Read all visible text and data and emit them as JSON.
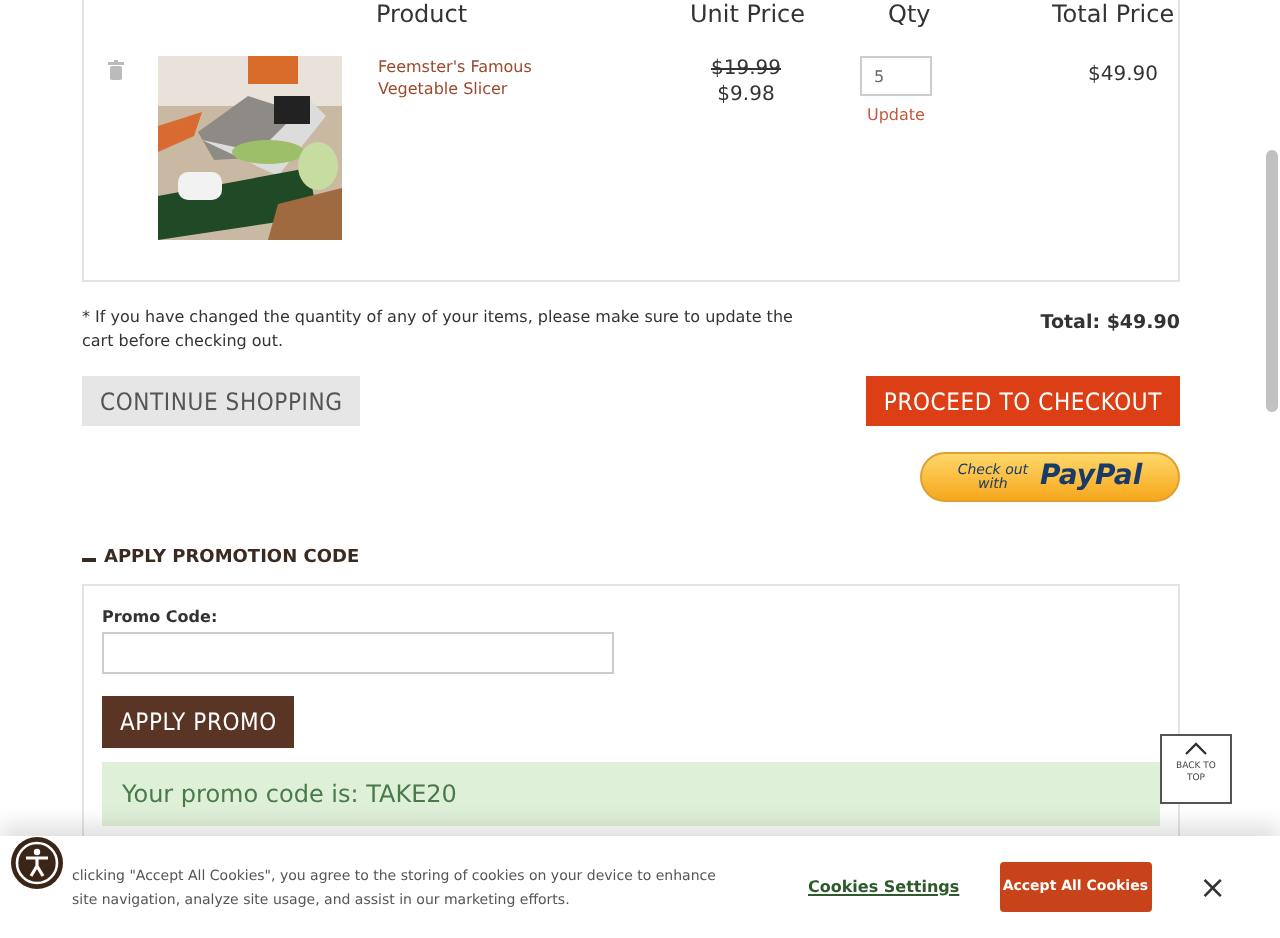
{
  "cart": {
    "columns": [
      "Product",
      "Unit Price",
      "Qty",
      "Total Price"
    ],
    "items": [
      {
        "name": "Feemster's Famous Vegetable Slicer",
        "original_price": "$19.99",
        "price": "$9.98",
        "qty": "5",
        "update": "Update",
        "total": "$49.90"
      }
    ],
    "note": "* If you have changed the quantity of any of your items, please make sure to update the cart before checking out.",
    "total": "Total: $49.90",
    "continue_button": "CONTINUE SHOPPING",
    "checkout_button": "PROCEED TO CHECKOUT",
    "paypal": {
      "line1": "Check out",
      "line2": "with",
      "brand": "PayPal"
    }
  },
  "promo": {
    "heading": "APPLY PROMOTION CODE",
    "expanded": true,
    "label": "Promo Code:",
    "button": "APPLY PROMO",
    "message": "Your promo code is: TAKE20"
  },
  "back_to_top": "BACK TO TOP",
  "cookie_banner": {
    "text": "clicking \"Accept All Cookies\", you agree to the storing of cookies on your device to enhance site navigation, analyze site usage, and assist in our marketing efforts.",
    "settings": "Cookies Settings",
    "accept": "Accept All Cookies",
    "close": "×"
  }
}
